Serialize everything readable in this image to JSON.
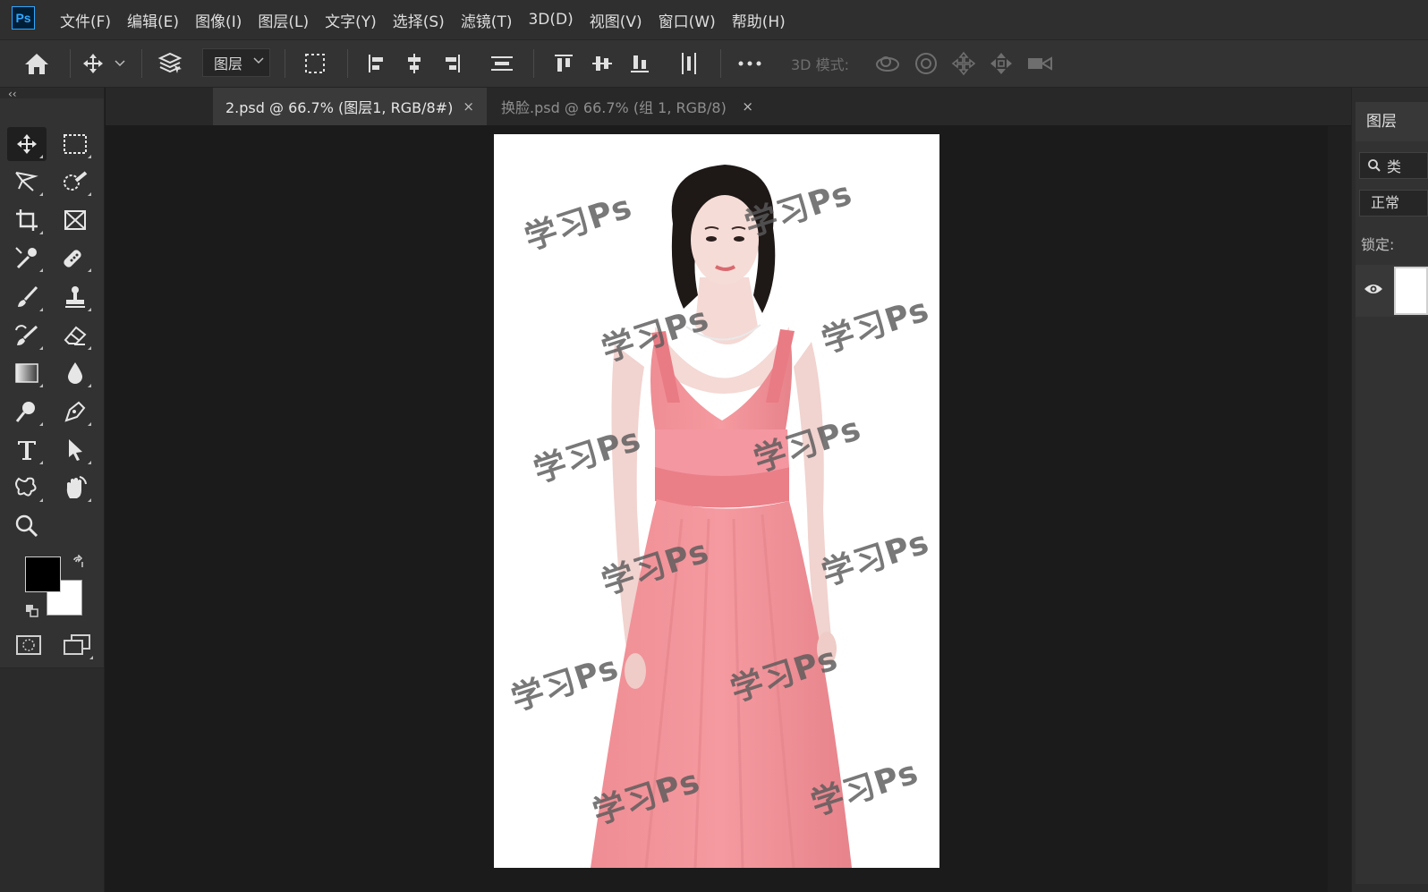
{
  "app": {
    "logo_text": "Ps"
  },
  "menu": [
    "文件(F)",
    "编辑(E)",
    "图像(I)",
    "图层(L)",
    "文字(Y)",
    "选择(S)",
    "滤镜(T)",
    "3D(D)",
    "视图(V)",
    "窗口(W)",
    "帮助(H)"
  ],
  "options_bar": {
    "auto_select_target": "图层",
    "mode_3d_label": "3D 模式:",
    "icons": [
      "home-icon",
      "move-icon",
      "layer-stack-icon",
      "transform-controls-icon",
      "align-left-icon",
      "align-hcenter-icon",
      "align-right-icon",
      "distribute-vertical-icon",
      "align-top-icon",
      "align-vcenter-icon",
      "align-bottom-icon",
      "distribute-horizontal-icon",
      "more-icon",
      "orbit-3d-icon",
      "roll-3d-icon",
      "pan-3d-icon",
      "slide-3d-icon",
      "camera-3d-icon"
    ]
  },
  "tabs": [
    {
      "label": "2.psd @ 66.7% (图层1, RGB/8#)",
      "active": true,
      "close": "×"
    },
    {
      "label": "换脸.psd @ 66.7% (组 1, RGB/8)",
      "active": false,
      "close": "×"
    }
  ],
  "toolbar": {
    "collapse": "‹‹",
    "tools": [
      "move",
      "marquee",
      "lasso",
      "quick-select",
      "crop",
      "frame",
      "eyedropper",
      "healing",
      "brush",
      "stamp",
      "history-brush",
      "eraser",
      "gradient",
      "blur",
      "dodge",
      "pen",
      "type",
      "path-select",
      "shape",
      "hand",
      "zoom"
    ],
    "foreground_color": "#000000",
    "background_color": "#ffffff"
  },
  "canvas": {
    "watermark_text": "学习Ps"
  },
  "layers_panel": {
    "title": "图层",
    "search_placeholder": "类",
    "blend_mode": "正常",
    "lock_label": "锁定:"
  }
}
